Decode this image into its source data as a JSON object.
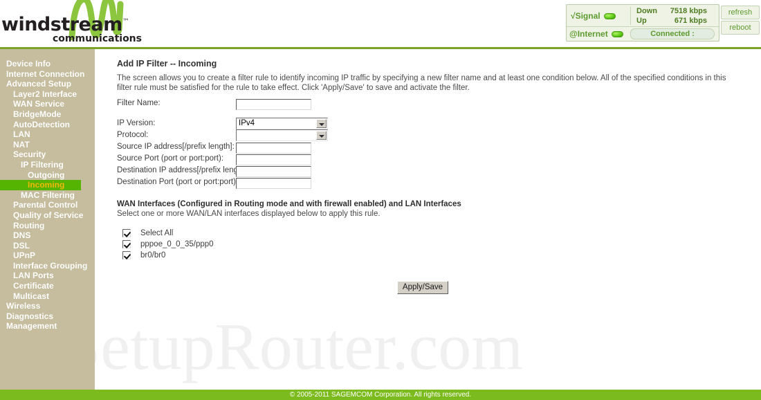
{
  "brand": {
    "name": "windstream",
    "trademark": "™",
    "tagline": "communications"
  },
  "status": {
    "signal_label": "√Signal",
    "internet_label": "@Internet",
    "down_label": "Down",
    "down_value": "7518 kbps",
    "up_label": "Up",
    "up_value": "671 kbps",
    "connection_state": "Connected :",
    "refresh_label": "refresh",
    "reboot_label": "reboot",
    "led_color": "#5fcc18",
    "accent_color": "#5d9a2e"
  },
  "sidebar": {
    "bg_color": "#c5bd9d",
    "selected_bg": "#55b402",
    "selected_fg": "#f5b800",
    "items": [
      {
        "label": "Device Info",
        "level": 0,
        "selected": false
      },
      {
        "label": "Internet Connection",
        "level": 0,
        "selected": false
      },
      {
        "label": "Advanced Setup",
        "level": 0,
        "selected": false
      },
      {
        "label": "Layer2 Interface",
        "level": 1,
        "selected": false
      },
      {
        "label": "WAN Service",
        "level": 1,
        "selected": false
      },
      {
        "label": "BridgeMode",
        "level": 1,
        "selected": false
      },
      {
        "label": "AutoDetection",
        "level": 1,
        "selected": false
      },
      {
        "label": "LAN",
        "level": 1,
        "selected": false
      },
      {
        "label": "NAT",
        "level": 1,
        "selected": false
      },
      {
        "label": "Security",
        "level": 1,
        "selected": false
      },
      {
        "label": "IP Filtering",
        "level": 2,
        "selected": false
      },
      {
        "label": "Outgoing",
        "level": 3,
        "selected": false
      },
      {
        "label": "Incoming",
        "level": 3,
        "selected": true
      },
      {
        "label": "MAC Filtering",
        "level": 2,
        "selected": false
      },
      {
        "label": "Parental Control",
        "level": 1,
        "selected": false
      },
      {
        "label": "Quality of Service",
        "level": 1,
        "selected": false
      },
      {
        "label": "Routing",
        "level": 1,
        "selected": false
      },
      {
        "label": "DNS",
        "level": 1,
        "selected": false
      },
      {
        "label": "DSL",
        "level": 1,
        "selected": false
      },
      {
        "label": "UPnP",
        "level": 1,
        "selected": false
      },
      {
        "label": "Interface Grouping",
        "level": 1,
        "selected": false
      },
      {
        "label": "LAN Ports",
        "level": 1,
        "selected": false
      },
      {
        "label": "Certificate",
        "level": 1,
        "selected": false
      },
      {
        "label": "Multicast",
        "level": 1,
        "selected": false
      },
      {
        "label": "Wireless",
        "level": 0,
        "selected": false
      },
      {
        "label": "Diagnostics",
        "level": 0,
        "selected": false
      },
      {
        "label": "Management",
        "level": 0,
        "selected": false
      }
    ]
  },
  "main": {
    "title": "Add IP Filter -- Incoming",
    "description": "The screen allows you to create a filter rule to identify incoming IP traffic by specifying a new filter name and at least one condition below. All of the specified conditions in this filter rule must be satisfied for the rule to take effect. Click 'Apply/Save' to save and activate the filter.",
    "fields": [
      {
        "label": "Filter Name:",
        "type": "text",
        "value": "",
        "gap_after": 12
      },
      {
        "label": "IP Version:",
        "type": "select",
        "value": "IPv4",
        "gap_after": 0
      },
      {
        "label": "Protocol:",
        "type": "select",
        "value": "",
        "gap_after": 0
      },
      {
        "label": "Source IP address[/prefix length]:",
        "type": "text",
        "value": "",
        "gap_after": 0
      },
      {
        "label": "Source Port (port or port:port):",
        "type": "text",
        "value": "",
        "gap_after": 0
      },
      {
        "label": "Destination IP address[/prefix length]:",
        "type": "text",
        "value": "",
        "gap_after": 0
      },
      {
        "label": "Destination Port (port or port:port):",
        "type": "text",
        "value": "",
        "gap_after": 0
      }
    ],
    "wan_section": {
      "title": "WAN Interfaces (Configured in Routing mode and with firewall enabled) and LAN Interfaces",
      "subtitle": "Select one or more WAN/LAN interfaces displayed below to apply this rule.",
      "interfaces": [
        {
          "label": "Select All",
          "checked": true
        },
        {
          "label": "pppoe_0_0_35/ppp0",
          "checked": true
        },
        {
          "label": "br0/br0",
          "checked": true
        }
      ]
    },
    "apply_label": "Apply/Save",
    "watermark": "SetupRouter.com"
  },
  "footer": {
    "text": "© 2005-2011 SAGEMCOM Corporation. All rights reserved.",
    "bg_color": "#7cbb1e"
  }
}
